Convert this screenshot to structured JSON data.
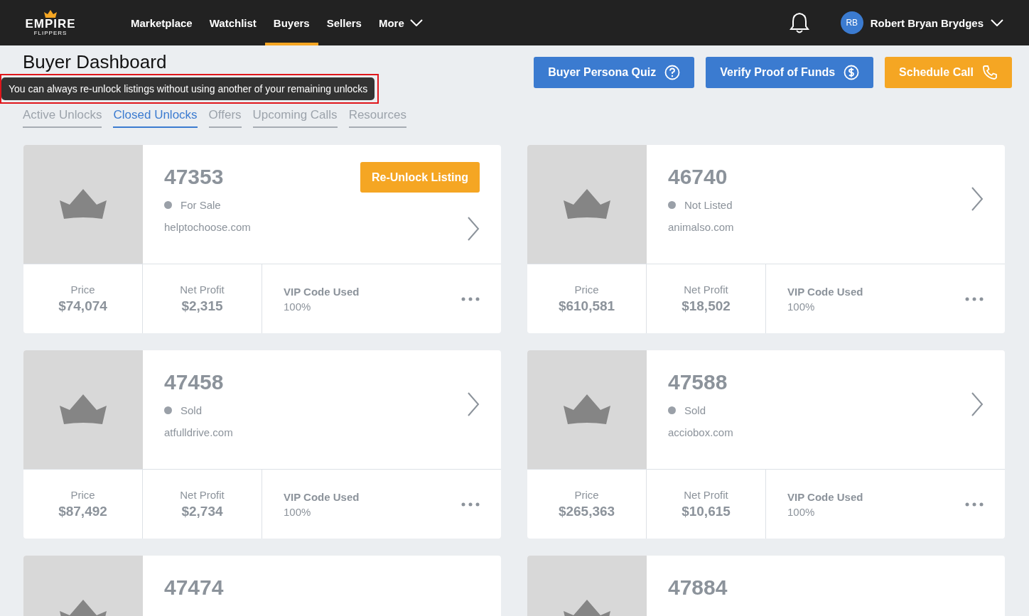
{
  "nav": {
    "logo": {
      "top": "EMPIRE",
      "bottom": "FLIPPERS"
    },
    "items": [
      {
        "label": "Marketplace",
        "selected": false,
        "kind": "link"
      },
      {
        "label": "Watchlist",
        "selected": false,
        "kind": "link"
      },
      {
        "label": "Buyers",
        "selected": true,
        "kind": "link"
      },
      {
        "label": "Sellers",
        "selected": false,
        "kind": "link"
      },
      {
        "label": "More",
        "selected": false,
        "kind": "dropdown"
      }
    ],
    "user": {
      "initials": "RB",
      "name": "Robert Bryan Brydges"
    }
  },
  "page": {
    "title": "Buyer Dashboard",
    "tooltip": "You can always re-unlock listings without using another of your remaining unlocks",
    "actions": [
      {
        "label": "Buyer Persona Quiz",
        "kind": "quiz"
      },
      {
        "label": "Verify Proof of Funds",
        "kind": "funds"
      },
      {
        "label": "Schedule Call",
        "kind": "call"
      }
    ],
    "tabs": [
      {
        "label": "Active Unlocks",
        "selected": false
      },
      {
        "label": "Closed Unlocks",
        "selected": true
      },
      {
        "label": "Offers",
        "selected": false
      },
      {
        "label": "Upcoming Calls",
        "selected": false
      },
      {
        "label": "Resources",
        "selected": false
      }
    ]
  },
  "listings": [
    {
      "number": "47353",
      "status": "For Sale",
      "domain": "helptochoose.com",
      "action": "Re-Unlock Listing",
      "price_label": "Price",
      "price": "$74,074",
      "profit_label": "Net Profit",
      "profit": "$2,315",
      "vip_label": "VIP Code Used",
      "vip": "100%"
    },
    {
      "number": "46740",
      "status": "Not Listed",
      "domain": "animalso.com",
      "price_label": "Price",
      "price": "$610,581",
      "profit_label": "Net Profit",
      "profit": "$18,502",
      "vip_label": "VIP Code Used",
      "vip": "100%"
    },
    {
      "number": "47458",
      "status": "Sold",
      "domain": "atfulldrive.com",
      "price_label": "Price",
      "price": "$87,492",
      "profit_label": "Net Profit",
      "profit": "$2,734",
      "vip_label": "VIP Code Used",
      "vip": "100%"
    },
    {
      "number": "47588",
      "status": "Sold",
      "domain": "acciobox.com",
      "price_label": "Price",
      "price": "$265,363",
      "profit_label": "Net Profit",
      "profit": "$10,615",
      "vip_label": "VIP Code Used",
      "vip": "100%"
    },
    {
      "number": "47474"
    },
    {
      "number": "47884"
    }
  ]
}
